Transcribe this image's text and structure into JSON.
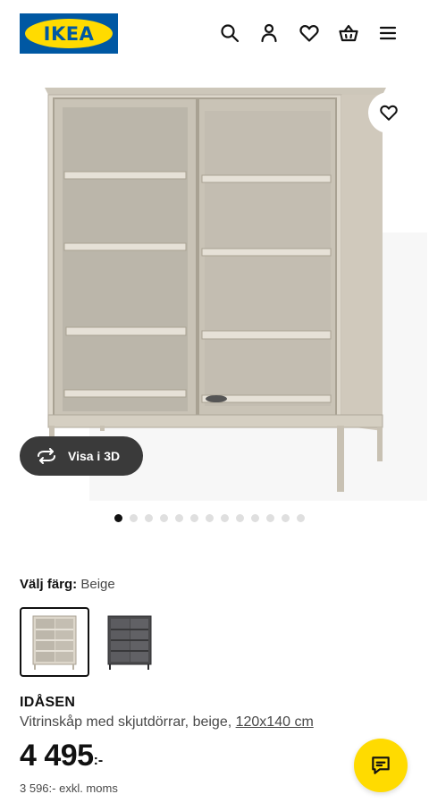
{
  "header": {
    "logo_text": "IKEA",
    "icons": [
      "search-icon",
      "account-icon",
      "heart-icon",
      "basket-icon",
      "menu-icon"
    ]
  },
  "gallery": {
    "view_3d_label": "Visa i 3D",
    "dot_count": 13,
    "active_dot": 0
  },
  "color_picker": {
    "label": "Välj färg:",
    "selected_value": "Beige",
    "options": [
      "Beige",
      "Dark grey"
    ]
  },
  "product": {
    "name": "IDÅSEN",
    "description": "Vitrinskåp med skjutdörrar, beige,",
    "size": "120x140 cm",
    "price": "4 495",
    "price_suffix": ":-",
    "price_ex_vat": "3 596:- exkl. moms"
  },
  "colors": {
    "brand_blue": "#0058a3",
    "brand_yellow": "#ffdb00",
    "cabinet_beige": "#d6d0c4",
    "cabinet_dark": "#4a4a4c"
  }
}
